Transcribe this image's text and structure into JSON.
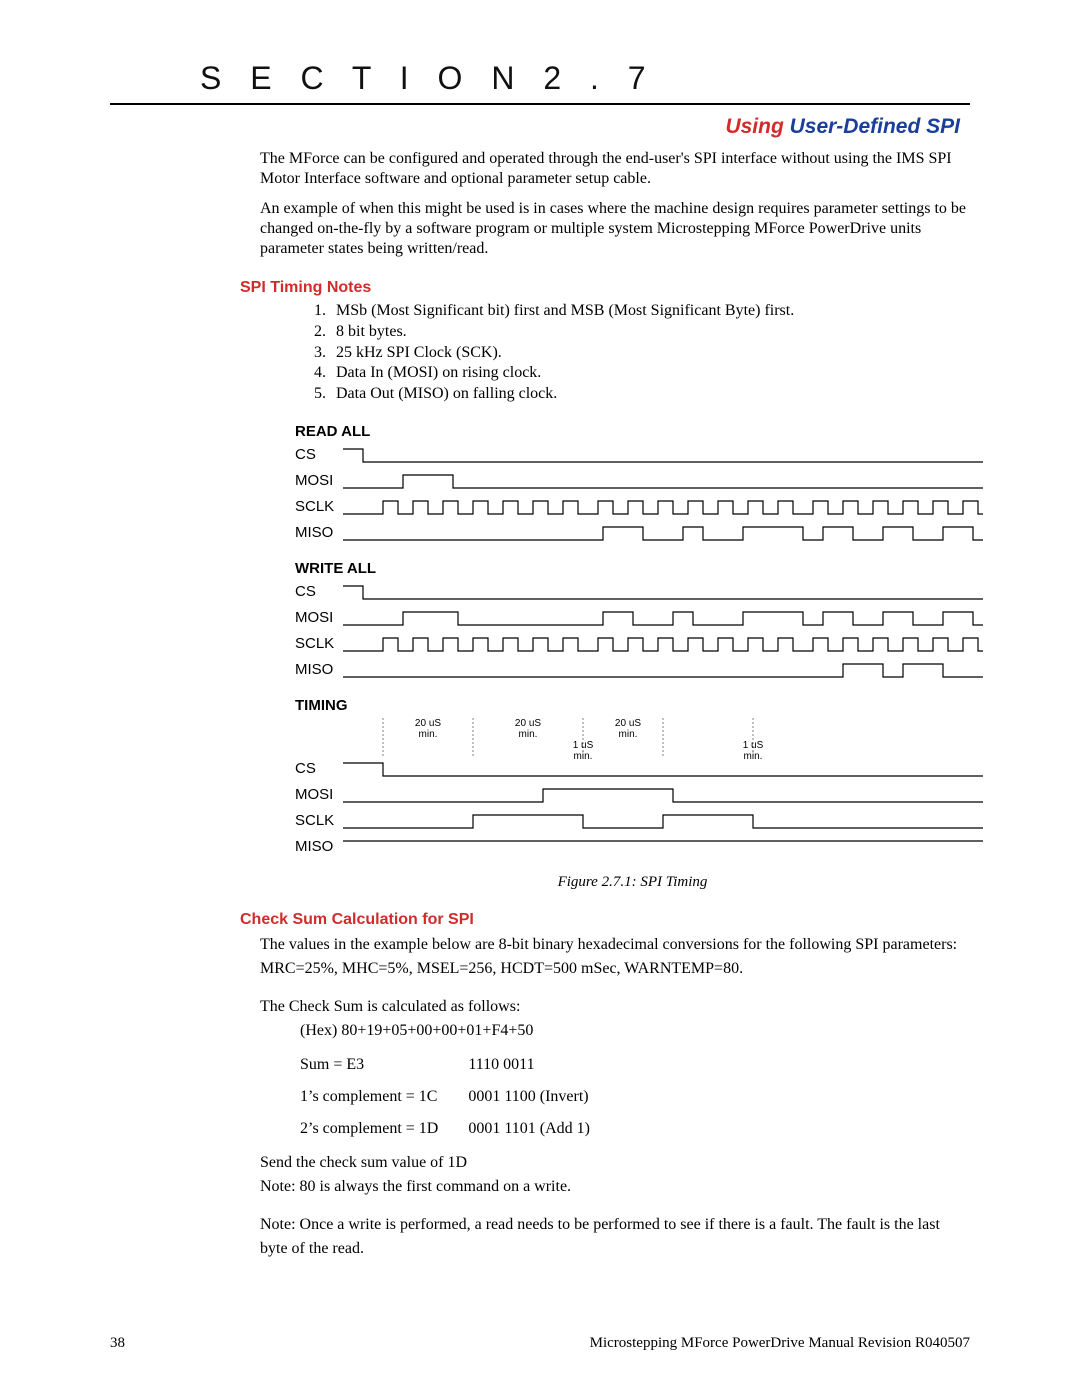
{
  "section": {
    "label": "S E C T I O N   2 . 7"
  },
  "heading": {
    "red": "Using ",
    "blue": "User-Defined SPI"
  },
  "paragraphs": {
    "intro1": "The MForce can be configured and operated through the end-user's SPI interface without using the IMS SPI Motor Interface software and optional parameter setup cable.",
    "intro2": "An example of when this might be used is in cases where the machine design requires parameter settings to be changed on-the-fly by a software program or multiple system Microstepping MForce PowerDrive units parameter states being written/read."
  },
  "spi_timing_notes": {
    "title": "SPI Timing Notes",
    "items": [
      "MSb (Most Significant bit) first and MSB (Most Significant Byte) first.",
      "8 bit bytes.",
      "25 kHz SPI Clock (SCK).",
      "Data In (MOSI) on rising clock.",
      "Data Out (MISO) on falling clock."
    ]
  },
  "diagrams": {
    "read_all": "READ ALL",
    "write_all": "WRITE  ALL",
    "timing": "TIMING",
    "signals": {
      "cs": "CS",
      "mosi": "MOSI",
      "sclk": "SCLK",
      "miso": "MISO"
    },
    "annot_20us": "20 uS\nmin.",
    "annot_1us": "1 uS\nmin.",
    "caption": "Figure 2.7.1: SPI Timing"
  },
  "checksum": {
    "title": "Check Sum Calculation for SPI",
    "p1": "The values in the example below are 8-bit binary hexadecimal conversions for the following SPI parameters: MRC=25%, MHC=5%, MSEL=256, HCDT=500 mSec, WARNTEMP=80.",
    "p2": "The Check Sum is calculated as follows:",
    "hex_line": "(Hex) 80+19+05+00+00+01+F4+50",
    "rows": [
      {
        "left": "Sum = E3",
        "right": "1110 0011"
      },
      {
        "left": "1’s complement = 1C",
        "right": "0001 1100 (Invert)"
      },
      {
        "left": "2’s complement = 1D",
        "right": "0001 1101 (Add 1)"
      }
    ],
    "send": "Send the check sum value of 1D",
    "note80": "Note: 80 is always the first command on a write.",
    "note_read": "Note: Once a write is performed, a read needs to be performed to see if there is a fault. The fault is the last byte of the read."
  },
  "footer": {
    "page": "38",
    "doc": "Microstepping MForce PowerDrive Manual Revision R040507"
  }
}
